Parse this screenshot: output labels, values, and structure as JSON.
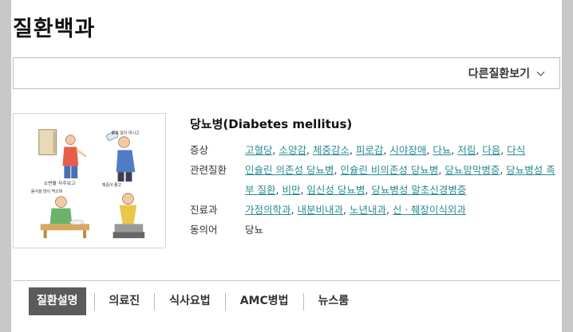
{
  "page": {
    "title": "질환백과"
  },
  "other_disease": {
    "label": "다른질환보기"
  },
  "disease": {
    "name": "당뇨병(Diabetes mellitus)",
    "image_captions": [
      "소변을 자주보고",
      "물을 많이 마시고",
      "음식을 많이 먹으며",
      "체중이 줄고"
    ],
    "fields": {
      "symptoms_label": "증상",
      "symptoms": [
        "고혈당",
        "소양감",
        "체중감소",
        "피로감",
        "시야장애",
        "다뇨",
        "저림",
        "다음",
        "다식"
      ],
      "related_label": "관련질환",
      "related": [
        "인슐린 의존성 당뇨병",
        "인슐린 비의존성 당뇨병",
        "당뇨망막병증",
        "당뇨병성 족부 질환",
        "비만",
        "임신성 당뇨병",
        "당뇨병성 말초신경병증"
      ],
      "dept_label": "진료과",
      "depts": [
        "가정의학과",
        "내분비내과",
        "노년내과",
        "신ㆍ췌장이식외과"
      ],
      "synonym_label": "동의어",
      "synonym": "당뇨"
    }
  },
  "tabs": [
    "질환설명",
    "의료진",
    "식사요법",
    "AMC병법",
    "뉴스룸"
  ]
}
